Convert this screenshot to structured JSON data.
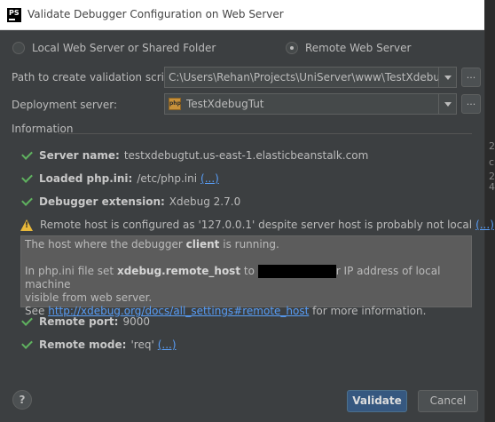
{
  "window": {
    "app_icon": "PS",
    "title": "Validate Debugger Configuration on Web Server"
  },
  "mode": {
    "local_label": "Local Web Server or Shared Folder",
    "remote_label": "Remote Web Server",
    "selected": "remote"
  },
  "path": {
    "label": "Path to create validation script:",
    "value": "C:\\Users\\Rehan\\Projects\\UniServer\\www\\TestXdebugTut",
    "browse": "..."
  },
  "deployment": {
    "label": "Deployment server:",
    "value": "TestXdebugTut",
    "icon": "php-server-icon",
    "icon_text": "php",
    "more": "..."
  },
  "info": {
    "title": "Information",
    "server_name_label": "Server name:",
    "server_name_value": "testxdebugtut.us-east-1.elasticbeanstalk.com",
    "php_ini_label": "Loaded php.ini:",
    "php_ini_value": "/etc/php.ini",
    "php_ini_link": "(...)",
    "debugger_label": "Debugger extension:",
    "debugger_value": "Xdebug 2.7.0",
    "warning_text": "Remote host is configured as '127.0.0.1' despite server host is probably not local",
    "warning_link": "(...)",
    "tip_line1_a": "The host where the debugger",
    "tip_line1_b": "client",
    "tip_line1_c": "is running.",
    "tip_line2_a": "In php.ini file set",
    "tip_line2_b": "xdebug.remote_host",
    "tip_line2_c": "to",
    "tip_line2_d": "r IP address of local machine",
    "tip_line3": "visible from web server.",
    "tip_line4_a": "See",
    "tip_line4_link": "http://xdebug.org/docs/all_settings#remote_host",
    "tip_line4_b": "for more information.",
    "port_label": "Remote port:",
    "port_value": "9000",
    "mode_label": "Remote mode:",
    "mode_value": "'req'",
    "mode_link": "(...)"
  },
  "buttons": {
    "help": "?",
    "validate": "Validate",
    "cancel": "Cancel"
  },
  "side": {
    "chars": [
      "2",
      "c",
      "2",
      "4"
    ]
  },
  "colors": {
    "accent": "#365880",
    "success": "#5fb25f",
    "warning": "#e8b83a",
    "link": "#589df6"
  }
}
